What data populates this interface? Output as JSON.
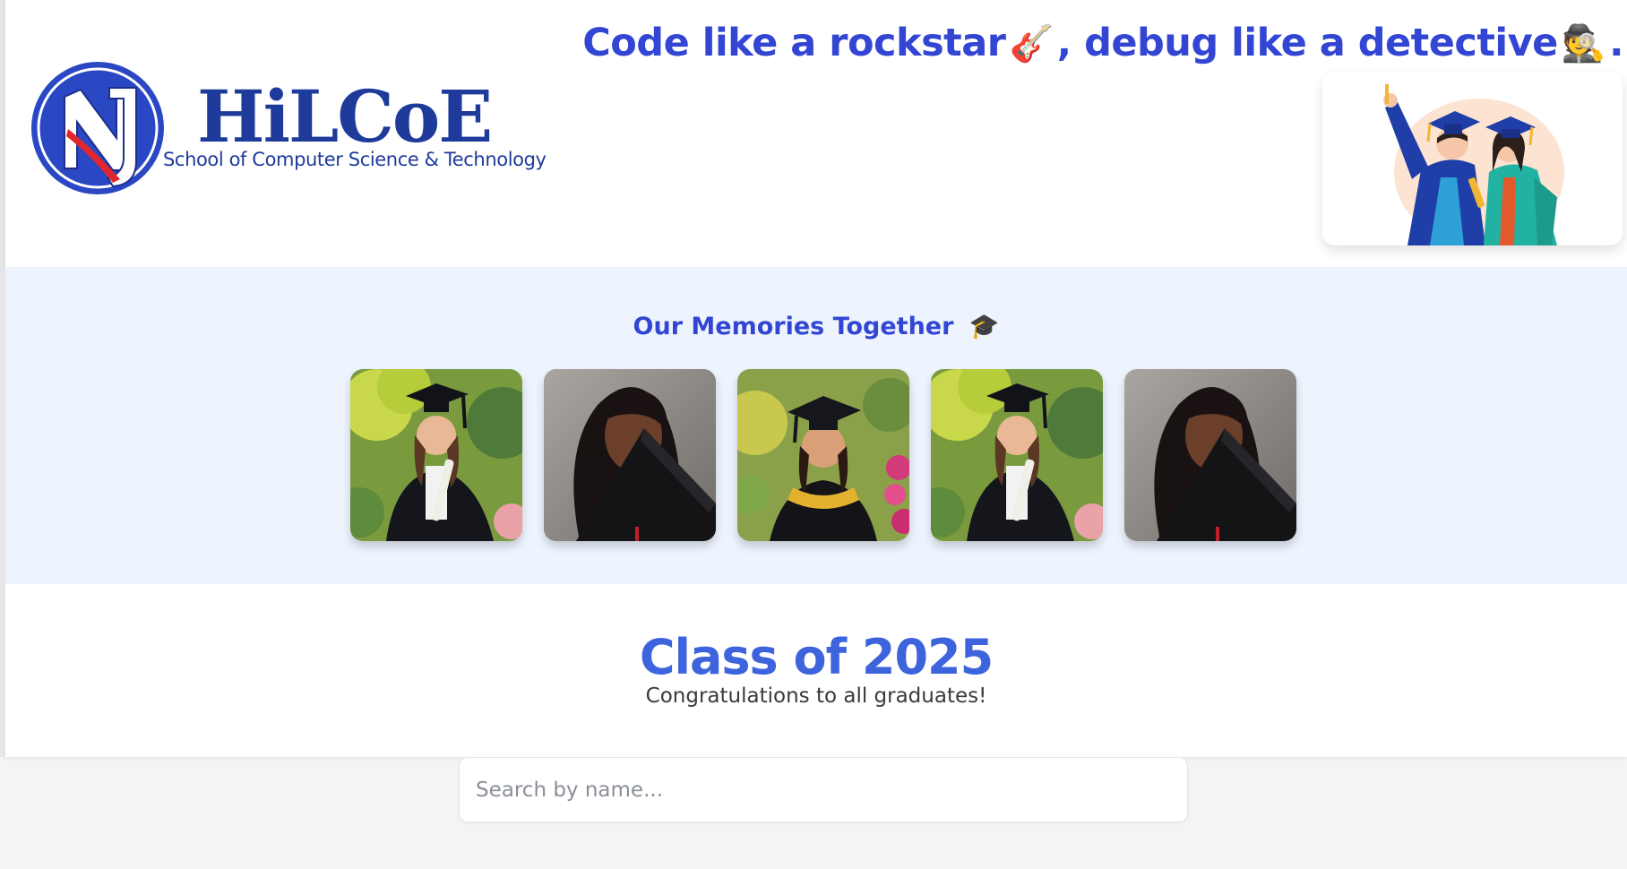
{
  "header": {
    "tagline": {
      "part1": "Code like a rockstar",
      "emoji1": "🎸",
      "part2": ", debug like a detective",
      "emoji2": "🕵️",
      "end": "."
    },
    "logo": {
      "wordmark": "HiLCoE",
      "subtitle": "School of Computer Science & Technology"
    },
    "illustration_icon": "graduates-illustration-icon"
  },
  "memories": {
    "title": "Our Memories Together",
    "title_emoji": "🎓",
    "photos": [
      {
        "name": "graduate-photo-1"
      },
      {
        "name": "graduate-photo-2"
      },
      {
        "name": "graduate-photo-3"
      },
      {
        "name": "graduate-photo-4"
      },
      {
        "name": "graduate-photo-5"
      }
    ]
  },
  "class_section": {
    "title": "Class of 2025",
    "subtitle": "Congratulations to all graduates!"
  },
  "search": {
    "placeholder": "Search by name...",
    "value": ""
  },
  "colors": {
    "accent": "#3346d3",
    "title_blue": "#3d63dd",
    "logo_blue": "#1e3a9b",
    "memories_bg": "#eef4fe",
    "page_bg": "#f3f4f6"
  }
}
